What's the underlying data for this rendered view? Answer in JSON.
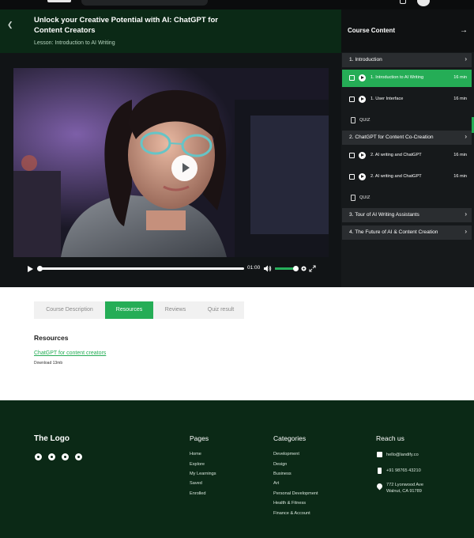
{
  "course": {
    "title": "Unlock your Creative Potential with AI: ChatGPT for Content Creators",
    "lesson_line": "Lesson: Introduction to AI Writing"
  },
  "player": {
    "time": "01:00",
    "progress_fraction": 0.01,
    "volume_fraction": 1.0
  },
  "sidebar": {
    "title": "Course Content",
    "sections": [
      {
        "label": "1. Introduction",
        "items": [
          {
            "type": "lesson",
            "label": "1. Introduction to AI Writing",
            "duration": "16 min",
            "active": true
          },
          {
            "type": "lesson",
            "label": "1. User Interface",
            "duration": "16 min",
            "active": false
          },
          {
            "type": "quiz",
            "label": "QUIZ"
          }
        ]
      },
      {
        "label": "2. ChatGPT for Content Co-Creation",
        "items": [
          {
            "type": "lesson",
            "label": "2. AI writing and ChatGPT",
            "duration": "16 min",
            "active": false
          },
          {
            "type": "lesson",
            "label": "2. AI writing and ChatGPT",
            "duration": "16 min",
            "active": false
          },
          {
            "type": "quiz",
            "label": "QUIZ"
          }
        ]
      },
      {
        "label": "3. Tour of AI Writing Assistants",
        "items": []
      },
      {
        "label": "4. The Future of AI & Content Creation",
        "items": []
      }
    ]
  },
  "tabs": [
    {
      "label": "Course Description",
      "active": false
    },
    {
      "label": "Resources",
      "active": true
    },
    {
      "label": "Reviews",
      "active": false
    },
    {
      "label": "Quiz result",
      "active": false
    }
  ],
  "resources": {
    "heading": "Resources",
    "link_text": "ChatGPT for content creators",
    "download_text": "Download 13mb"
  },
  "footer": {
    "logo": "The Logo",
    "social_icons": [
      "instagram-icon",
      "dribbble-icon",
      "twitter-icon",
      "youtube-icon"
    ],
    "pages": {
      "heading": "Pages",
      "links": [
        "Home",
        "Explore",
        "My Learnings",
        "Saved",
        "Enrolled"
      ]
    },
    "categories": {
      "heading": "Categories",
      "links": [
        "Development",
        "Design",
        "Business",
        "Art",
        "Personal Development",
        "Health & Fitness",
        "Finance & Account"
      ]
    },
    "reach": {
      "heading": "Reach us",
      "email": "hello@landify.co",
      "phone": "+91 98765 43210",
      "address_line1": "772 Lyonwood Ave",
      "address_line2": "Walnut, CA 91789"
    }
  },
  "colors": {
    "brand_green": "#25ad56",
    "dark_green": "#0b2916",
    "sidebar_bg": "#16191b"
  }
}
